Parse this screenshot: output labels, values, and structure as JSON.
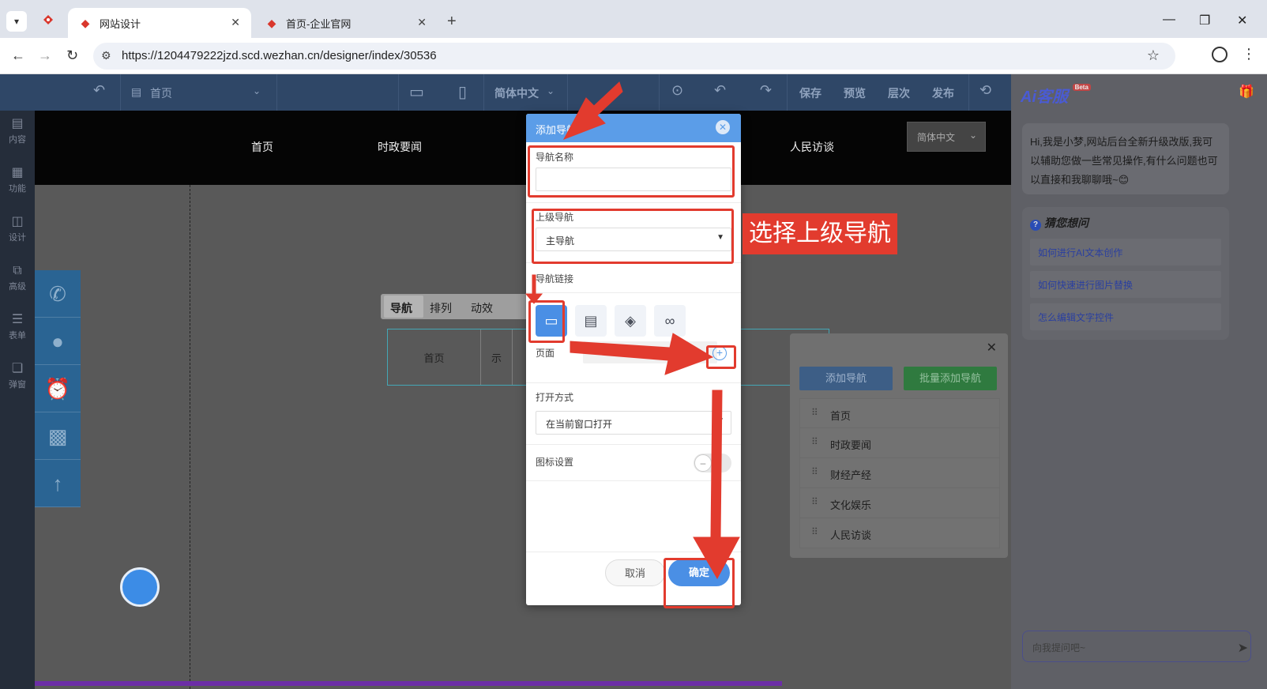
{
  "browser": {
    "tabs": [
      {
        "title": "网站设计",
        "active": true
      },
      {
        "title": "首页-企业官网",
        "active": false
      }
    ],
    "url": "https://1204479222jzd.scd.wezhan.cn/designer/index/30536"
  },
  "toolbar": {
    "page": "首页",
    "language": "简体中文",
    "save": "保存",
    "preview": "预览",
    "layers": "层次",
    "publish": "发布"
  },
  "sidebar": {
    "items": [
      {
        "label": "内容",
        "icon": "file-icon"
      },
      {
        "label": "功能",
        "icon": "grid-icon"
      },
      {
        "label": "设计",
        "icon": "layout-icon"
      },
      {
        "label": "高级",
        "icon": "code-icon"
      },
      {
        "label": "表单",
        "icon": "form-icon"
      },
      {
        "label": "弹窗",
        "icon": "popup-icon"
      }
    ]
  },
  "site": {
    "nav": [
      "首页",
      "时政要闻",
      "人民访谈"
    ],
    "language": "简体中文"
  },
  "widget_tabs": [
    "导航",
    "排列",
    "动效"
  ],
  "nav_widget": [
    "首页",
    "示"
  ],
  "right_panel": {
    "add_nav": "添加导航",
    "batch_add_nav": "批量添加导航",
    "items": [
      "首页",
      "时政要闻",
      "财经产经",
      "文化娱乐",
      "人民访谈"
    ]
  },
  "ai": {
    "logo": "Ai客服",
    "beta": "Beta",
    "greeting": "Hi,我是小梦,网站后台全新升级改版,我可以辅助您做一些常见操作,有什么问题也可以直接和我聊聊哦~😊",
    "guess_title": "猜您想问",
    "questions": [
      "如何进行AI文本创作",
      "如何快速进行图片替换",
      "怎么编辑文字控件"
    ],
    "input_placeholder": "向我提问吧~"
  },
  "modal": {
    "title": "添加导航",
    "name_label": "导航名称",
    "name_value": "",
    "parent_label": "上级导航",
    "parent_value": "主导航",
    "link_label": "导航链接",
    "page_label": "页面",
    "open_label": "打开方式",
    "open_value": "在当前窗口打开",
    "icon_label": "图标设置",
    "cancel": "取消",
    "confirm": "确定"
  },
  "annotation": {
    "callout": "选择上级导航"
  },
  "colors": {
    "accent_blue": "#4a8fe5",
    "annotation_red": "#e23b2e",
    "toolbar": "#2f4767"
  }
}
